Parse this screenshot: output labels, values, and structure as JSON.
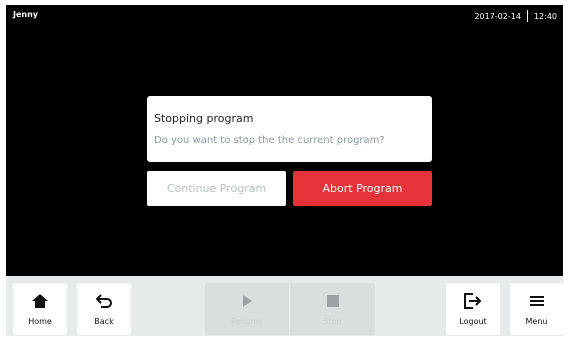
{
  "status": {
    "user": "Jenny",
    "date": "2017-02-14",
    "time": "12:40"
  },
  "dialog": {
    "title": "Stopping program",
    "message": "Do you want to stop the the current program?",
    "continue_label": "Continue Program",
    "abort_label": "Abort Program"
  },
  "toolbar": {
    "home": "Home",
    "back": "Back",
    "resume": "Resume",
    "stop": "Stop",
    "logout": "Logout",
    "menu": "Menu"
  },
  "icons": {
    "home": "home-icon",
    "back": "back-arrow-icon",
    "resume": "play-icon",
    "stop": "stop-icon",
    "logout": "logout-icon",
    "menu": "hamburger-menu-icon"
  },
  "colors": {
    "abort": "#e8323a",
    "screen": "#000000",
    "toolbar": "#e6eaea",
    "muted_text": "#8a9aa3"
  }
}
